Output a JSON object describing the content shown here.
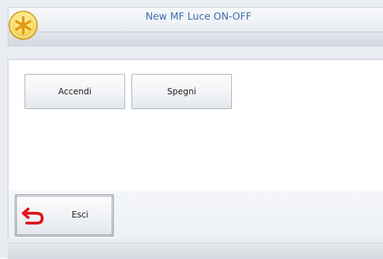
{
  "window": {
    "title": "New MF Luce ON-OFF",
    "title_color": "#3a6ea8",
    "app_icon": "asterisk-icon"
  },
  "actions": {
    "accendi_label": "Accendi",
    "spegni_label": "Spegni"
  },
  "footer": {
    "esci_label": "Esci",
    "esci_icon": "return-arrow-icon",
    "esci_icon_color": "#e3141b"
  }
}
